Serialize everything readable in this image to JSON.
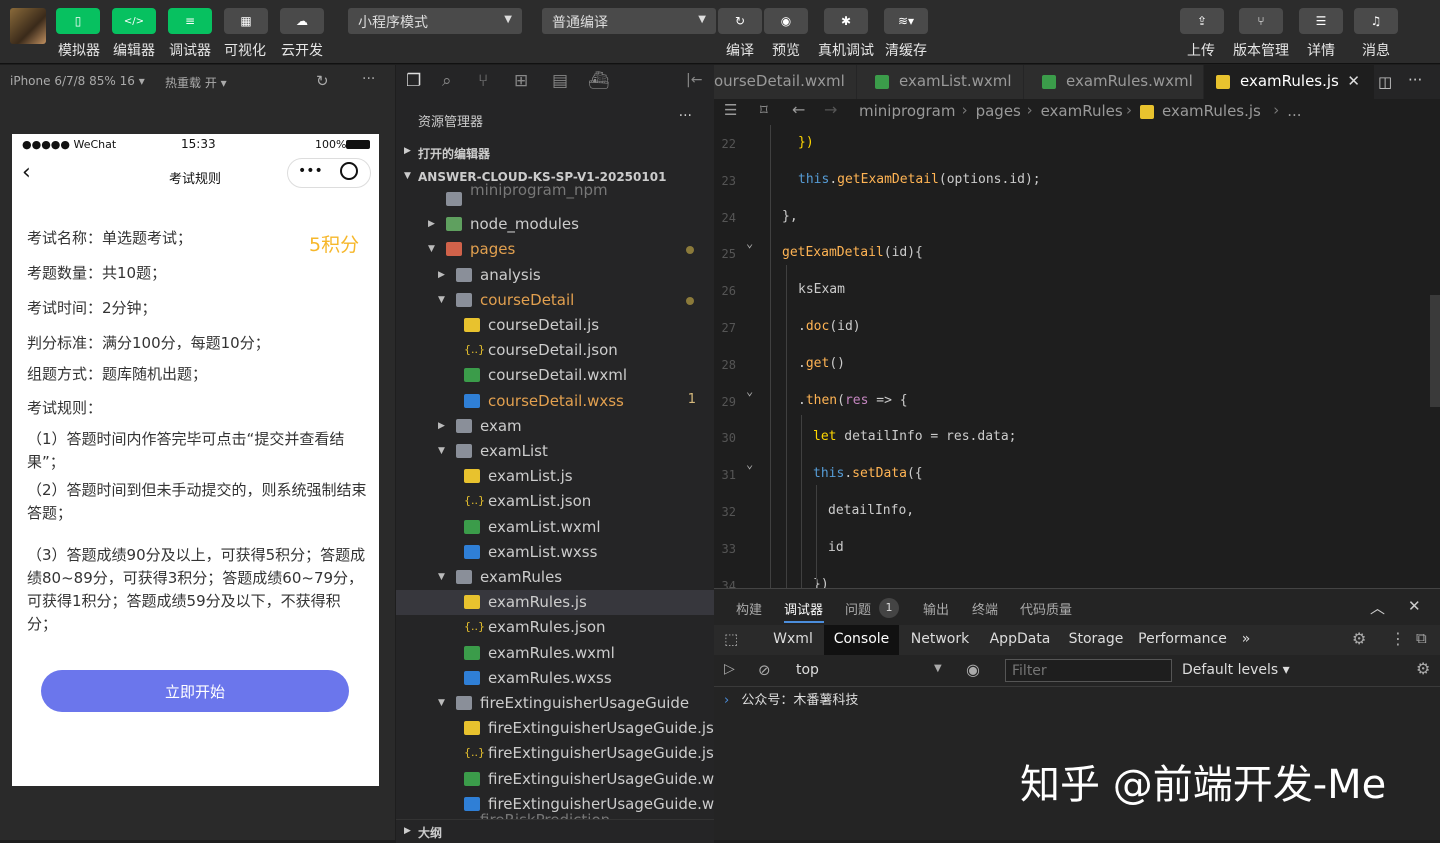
{
  "toolbar": {
    "buttons": [
      {
        "label": "模拟器",
        "icon": "phone-icon"
      },
      {
        "label": "编辑器",
        "icon": "code-icon"
      },
      {
        "label": "调试器",
        "icon": "sliders-icon"
      },
      {
        "label": "可视化",
        "icon": "layout-icon"
      },
      {
        "label": "云开发",
        "icon": "cloud-icon"
      }
    ],
    "mode_select": "小程序模式",
    "compile_select": "普通编译",
    "actions": [
      {
        "label": "编译",
        "icon": "refresh-icon"
      },
      {
        "label": "预览",
        "icon": "eye-icon"
      },
      {
        "label": "真机调试",
        "icon": "bug-icon"
      },
      {
        "label": "清缓存",
        "icon": "layers-icon"
      }
    ],
    "right_actions": [
      {
        "label": "上传",
        "icon": "upload-icon"
      },
      {
        "label": "版本管理",
        "icon": "branch-icon"
      },
      {
        "label": "详情",
        "icon": "menu-icon"
      },
      {
        "label": "消息",
        "icon": "bell-icon"
      }
    ]
  },
  "simulator": {
    "device": "iPhone 6/7/8 85% 16 ▾",
    "hot_reload": "热重载 开 ▾",
    "status_carrier": "●●●●● WeChat",
    "status_time": "15:33",
    "status_battery": "100%",
    "page_title": "考试规则",
    "points": "5积分",
    "lines": [
      "考试名称：单选题考试；",
      "考题数量：共10题；",
      "考试时间：2分钟；",
      "判分标准：满分100分，每题10分；",
      "组题方式：题库随机出题；",
      "考试规则："
    ],
    "rules": [
      "（1）答题时间内作答完毕可点击“提交并查看结果”；",
      "（2）答题时间到但未手动提交的，则系统强制结束答题；",
      "（3）答题成绩90分及以上，可获得5积分；答题成绩80~89分，可获得3积分；答题成绩60~79分，可获得1积分；答题成绩59分及以下，不获得积分；"
    ],
    "start_button": "立即开始"
  },
  "explorer": {
    "title": "资源管理器",
    "more": "···",
    "open_editors": "打开的编辑器",
    "project": "ANSWER-CLOUD-KS-SP-V1-20250101",
    "outline": "大纲",
    "tree": [
      {
        "label": "miniprogram_npm",
        "type": "folder",
        "depth": 1,
        "arrow": "",
        "partial": true
      },
      {
        "label": "node_modules",
        "type": "folder-green",
        "depth": 1,
        "arrow": "▶"
      },
      {
        "label": "pages",
        "type": "folder-red",
        "depth": 1,
        "arrow": "▼",
        "color": "#e2a04f",
        "dot": true
      },
      {
        "label": "analysis",
        "type": "folder",
        "depth": 2,
        "arrow": "▶"
      },
      {
        "label": "courseDetail",
        "type": "folder",
        "depth": 2,
        "arrow": "▼",
        "color": "#e2a04f",
        "dot": true
      },
      {
        "label": "courseDetail.js",
        "type": "js",
        "depth": 3
      },
      {
        "label": "courseDetail.json",
        "type": "json",
        "depth": 3
      },
      {
        "label": "courseDetail.wxml",
        "type": "wxml",
        "depth": 3
      },
      {
        "label": "courseDetail.wxss",
        "type": "wxss",
        "depth": 3,
        "color": "#e2a04f",
        "badge": "1"
      },
      {
        "label": "exam",
        "type": "folder",
        "depth": 2,
        "arrow": "▶"
      },
      {
        "label": "examList",
        "type": "folder",
        "depth": 2,
        "arrow": "▼"
      },
      {
        "label": "examList.js",
        "type": "js",
        "depth": 3
      },
      {
        "label": "examList.json",
        "type": "json",
        "depth": 3
      },
      {
        "label": "examList.wxml",
        "type": "wxml",
        "depth": 3
      },
      {
        "label": "examList.wxss",
        "type": "wxss",
        "depth": 3
      },
      {
        "label": "examRules",
        "type": "folder",
        "depth": 2,
        "arrow": "▼"
      },
      {
        "label": "examRules.js",
        "type": "js",
        "depth": 3,
        "selected": true
      },
      {
        "label": "examRules.json",
        "type": "json",
        "depth": 3
      },
      {
        "label": "examRules.wxml",
        "type": "wxml",
        "depth": 3
      },
      {
        "label": "examRules.wxss",
        "type": "wxss",
        "depth": 3
      },
      {
        "label": "fireExtinguisherUsageGuide",
        "type": "folder",
        "depth": 2,
        "arrow": "▼"
      },
      {
        "label": "fireExtinguisherUsageGuide.js",
        "type": "js",
        "depth": 3
      },
      {
        "label": "fireExtinguisherUsageGuide.json",
        "type": "json",
        "depth": 3
      },
      {
        "label": "fireExtinguisherUsageGuide.wxml",
        "type": "wxml",
        "depth": 3
      },
      {
        "label": "fireExtinguisherUsageGuide.wxss",
        "type": "wxss",
        "depth": 3
      },
      {
        "label": "fireRiskPrediction",
        "type": "folder",
        "depth": 2,
        "arrow": "",
        "partial": true
      }
    ]
  },
  "editor": {
    "tabs": [
      {
        "label": "ourseDetail.wxml",
        "type": "none"
      },
      {
        "label": "examList.wxml",
        "type": "wxml"
      },
      {
        "label": "examRules.wxml",
        "type": "wxml"
      },
      {
        "label": "examRules.js",
        "type": "js",
        "active": true
      }
    ],
    "breadcrumb": [
      "miniprogram",
      "pages",
      "examRules",
      "examRules.js",
      "..."
    ],
    "lines": [
      {
        "n": "22",
        "html": "<span class='y'>})</span>"
      },
      {
        "n": "23",
        "html": "<span class='k'>this</span>.<span class='o'>getExamDetail</span>(options.id);"
      },
      {
        "n": "24",
        "html": "},"
      },
      {
        "n": "25",
        "html": "<span class='o'>getExamDetail</span>(id){"
      },
      {
        "n": "26",
        "html": "ksExam"
      },
      {
        "n": "27",
        "html": ".<span class='o'>doc</span>(id)"
      },
      {
        "n": "28",
        "html": ".<span class='o'>get</span>()"
      },
      {
        "n": "29",
        "html": ".<span class='o'>then</span>(<span class='m'>res</span> => {"
      },
      {
        "n": "30",
        "html": "<span class='y'>let</span> detailInfo = res.data;"
      },
      {
        "n": "31",
        "html": "<span class='k'>this</span>.<span class='o'>setData</span>({"
      },
      {
        "n": "32",
        "html": "detailInfo,"
      },
      {
        "n": "33",
        "html": "id"
      },
      {
        "n": "34",
        "html": "})"
      }
    ]
  },
  "devtools": {
    "tabs": [
      "构建",
      "调试器",
      "问题",
      "输出",
      "终端",
      "代码质量"
    ],
    "issue_count": "1",
    "panels": [
      "Wxml",
      "Console",
      "Network",
      "AppData",
      "Storage",
      "Performance",
      "»"
    ],
    "context": "top",
    "filter_placeholder": "Filter",
    "levels": "Default levels ▾",
    "console_line": "公众号：木番薯科技"
  },
  "watermark": "知乎 @前端开发-Me"
}
